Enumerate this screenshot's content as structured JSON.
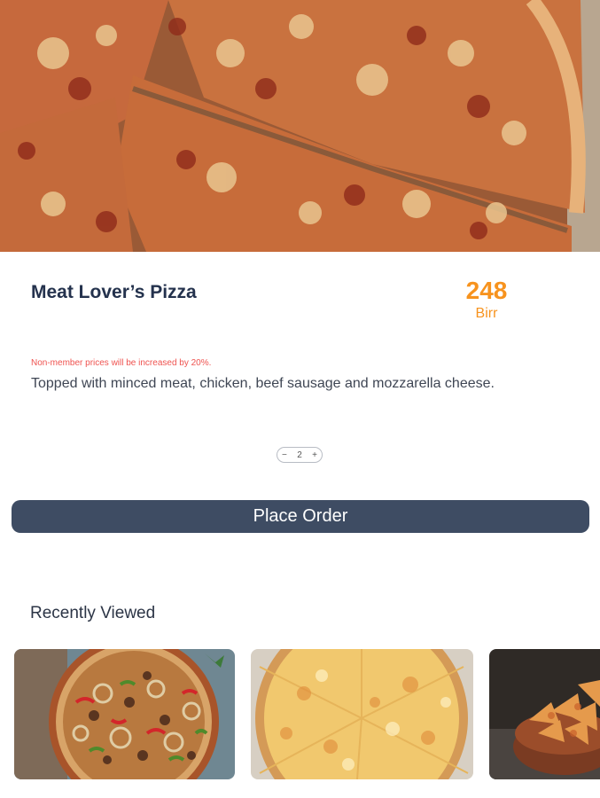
{
  "product": {
    "name": "Meat Lover’s Pizza",
    "price": "248",
    "currency": "Birr",
    "note": "Non-member prices will be increased by 20%.",
    "description": "Topped with minced meat, chicken, beef sausage and mozzarella cheese."
  },
  "quantity": {
    "minus": "−",
    "value": "2",
    "plus": "+"
  },
  "order_button": {
    "label": "Place Order"
  },
  "recently_viewed": {
    "title": "Recently Viewed",
    "items": [
      {
        "image": "supreme-pizza-image"
      },
      {
        "image": "cheese-pizza-image"
      },
      {
        "image": "chips-bowl-image"
      }
    ]
  },
  "colors": {
    "accent": "#f7931e",
    "button": "#3e4c63",
    "title": "#24324d",
    "warning": "#ef5350"
  }
}
